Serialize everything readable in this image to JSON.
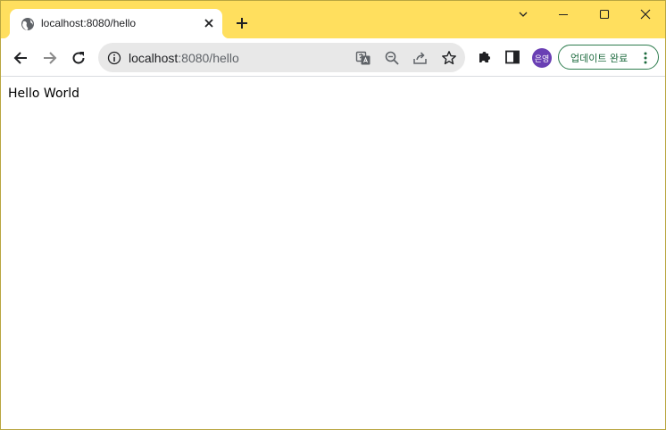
{
  "tab": {
    "title": "localhost:8080/hello",
    "favicon": "globe-icon"
  },
  "colors": {
    "titlebar": "#ffdf5e",
    "avatar": "#6a3fb4",
    "update_accent": "#2e7d4f"
  },
  "omnibox": {
    "host": "localhost",
    "path": ":8080/hello"
  },
  "profile": {
    "avatar_text": "은영"
  },
  "update_button": {
    "label": "업데이트 완료"
  },
  "page": {
    "text": "Hello World"
  }
}
